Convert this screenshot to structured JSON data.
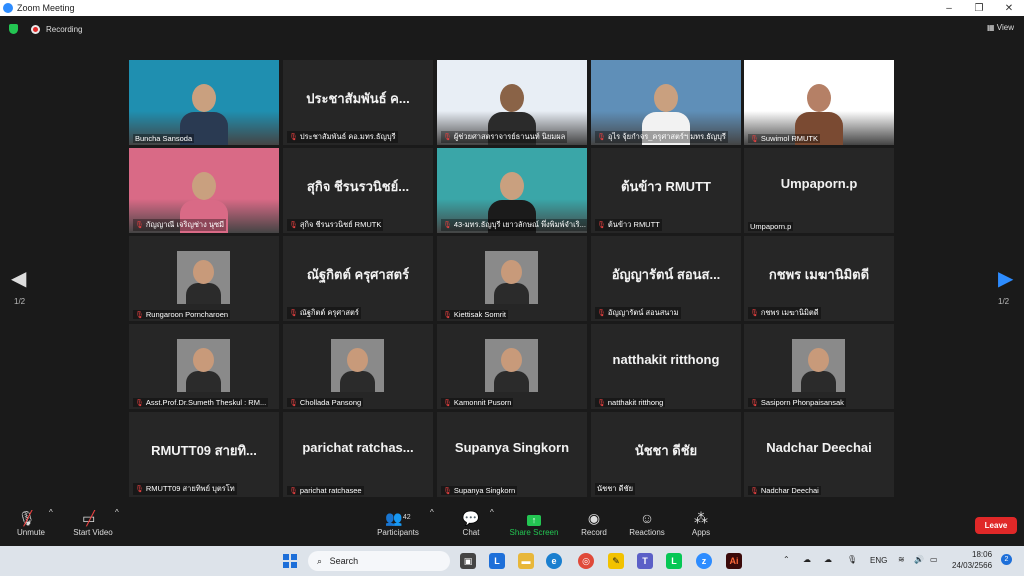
{
  "window": {
    "title": "Zoom Meeting",
    "minimize": "–",
    "maximize": "❐",
    "close": "✕"
  },
  "topbar": {
    "recording": "Recording",
    "view": "View"
  },
  "page_indicator": {
    "left": "1/2",
    "right": "1/2"
  },
  "tiles": [
    {
      "label": "Buncha Sansoda",
      "big": "",
      "video": true,
      "muted": false,
      "active": true
    },
    {
      "label": "ประชาสัมพันธ์ คอ.มทร.ธัญบุรี",
      "big": "ประชาสัมพันธ์ ค...",
      "video": false,
      "muted": true
    },
    {
      "label": "ผู้ช่วยศาสตราจารย์ธานนท์ นิยมผล",
      "big": "",
      "video": true,
      "muted": true
    },
    {
      "label": "อุไร จุ้ยกำจร_ครุศาสตร์ฯ มทร.ธัญบุรี",
      "big": "",
      "video": true,
      "muted": true
    },
    {
      "label": "Suwimol RMUTK",
      "big": "",
      "video": true,
      "muted": true
    },
    {
      "label": "กัญญาณี เจริญช่าง นุซมี",
      "big": "",
      "video": true,
      "muted": true
    },
    {
      "label": "สุกิจ ชีรนรวนิชย์ RMUTK",
      "big": "สุกิจ ชีรนรวนิชย์...",
      "video": false,
      "muted": true
    },
    {
      "label": "43-มทร.ธัญบุรี เยาวลักษณ์ พึ่งพิมพ์จำเริ...",
      "big": "",
      "video": true,
      "muted": true
    },
    {
      "label": "ต้นข้าว RMUTT",
      "big": "ต้นข้าว RMUTT",
      "video": false,
      "muted": true
    },
    {
      "label": "Umpaporn.p",
      "big": "Umpaporn.p",
      "video": false,
      "muted": false
    },
    {
      "label": "Rungaroon Porncharoen",
      "big": "",
      "video": false,
      "muted": true,
      "thumb": true
    },
    {
      "label": "ณัฐกิตต์ ครุศาสตร์",
      "big": "ณัฐกิตต์ ครุศาสตร์",
      "video": false,
      "muted": true
    },
    {
      "label": "Kiettisak Somrit",
      "big": "",
      "video": false,
      "muted": true,
      "thumb": true
    },
    {
      "label": "อัญญารัตน์ สอนสนาม",
      "big": "อัญญารัตน์ สอนส...",
      "video": false,
      "muted": true
    },
    {
      "label": "กชพร เมฆานิมิตดี",
      "big": "กชพร เมฆานิมิตดี",
      "video": false,
      "muted": true
    },
    {
      "label": "Asst.Prof.Dr.Sumeth Theskul : RM...",
      "big": "",
      "video": false,
      "muted": true,
      "thumb": true
    },
    {
      "label": "Chollada Pansong",
      "big": "",
      "video": false,
      "muted": true,
      "thumb": true
    },
    {
      "label": "Kamonnit Pusorn",
      "big": "",
      "video": false,
      "muted": true,
      "thumb": true
    },
    {
      "label": "natthakit ritthong",
      "big": "natthakit ritthong",
      "video": false,
      "muted": true
    },
    {
      "label": "Sasiporn Phonpaisansak",
      "big": "",
      "video": false,
      "muted": true,
      "thumb": true
    },
    {
      "label": "RMUTT09 สายทิพย์ บุตรโท",
      "big": "RMUTT09 สายทิ...",
      "video": false,
      "muted": true
    },
    {
      "label": "parichat ratchasee",
      "big": "parichat  ratchas...",
      "video": false,
      "muted": true
    },
    {
      "label": "Supanya Singkorn",
      "big": "Supanya Singkorn",
      "video": false,
      "muted": true
    },
    {
      "label": "นัชชา ดีชัย",
      "big": "นัชชา ดีชัย",
      "video": false,
      "muted": false
    },
    {
      "label": "Nadchar Deechai",
      "big": "Nadchar Deechai",
      "video": false,
      "muted": true
    }
  ],
  "toolbar": {
    "unmute": "Unmute",
    "start_video": "Start Video",
    "participants": "Participants",
    "participants_count": "42",
    "chat": "Chat",
    "share_screen": "Share Screen",
    "record": "Record",
    "reactions": "Reactions",
    "apps": "Apps",
    "leave": "Leave"
  },
  "taskbar": {
    "search": "Search",
    "lang": "ENG",
    "time": "18:06",
    "date": "24/03/2566",
    "notification_count": "2"
  },
  "colors": {
    "active_speaker": "#d9e843",
    "share_green": "#23c552",
    "leave_red": "#e02828",
    "muted_red": "#e84040",
    "zoom_blue": "#2d8cff"
  }
}
